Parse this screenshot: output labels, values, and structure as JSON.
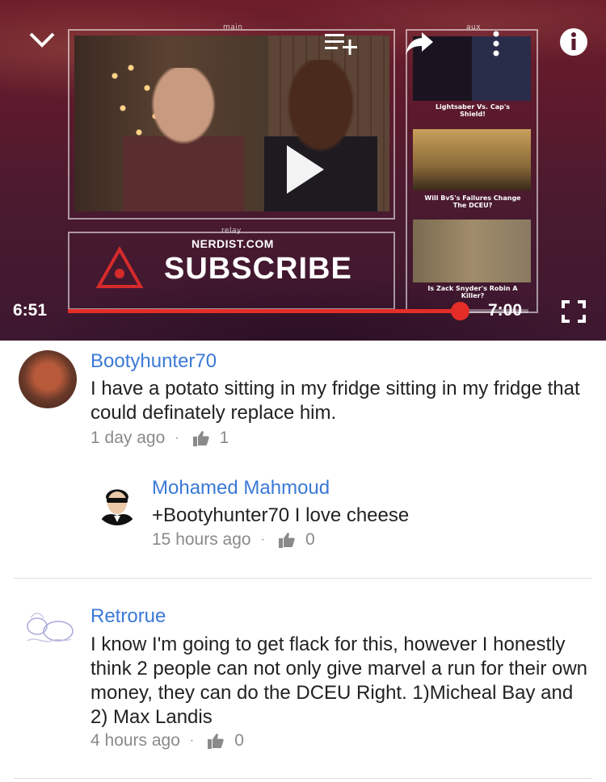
{
  "player": {
    "frame_main_label": "main",
    "frame_aux_label": "aux",
    "frame_relay_label": "relay",
    "nerdist": "NERDIST.COM",
    "subscribe": "SUBSCRIBE",
    "thumbs": [
      {
        "caption": "Lightsaber Vs. Cap's Shield!"
      },
      {
        "caption": "Will BvS's Failures Change The DCEU?"
      },
      {
        "caption": "Is Zack Snyder's Robin A Killer?"
      }
    ],
    "current_time": "6:51",
    "end_time": "7:00",
    "progress_fraction": 0.85,
    "icons": [
      "chevron-down-icon",
      "add-to-playlist-icon",
      "share-icon",
      "more-vert-icon",
      "info-icon",
      "fullscreen-icon",
      "play-icon",
      "warning-icon"
    ],
    "accent_color": "#e52d27"
  },
  "comments": [
    {
      "author": "Bootyhunter70",
      "text": "I have a potato sitting in my fridge sitting in my fridge that could definately replace him.",
      "time": "1 day ago",
      "likes": "1",
      "replies": [
        {
          "author": "Mohamed Mahmoud",
          "text": "+Bootyhunter70  I love cheese",
          "time": "15 hours ago",
          "likes": "0"
        }
      ]
    },
    {
      "author": "Retrorue",
      "text": "I know I'm going to get flack for this, however I honestly think 2 people can not only give marvel a run for their own money, they can do the DCEU Right. 1)Micheal Bay and 2) Max Landis",
      "time": "4 hours ago",
      "likes": "0"
    }
  ],
  "colors": {
    "author_link": "#3b79d6",
    "meta_text": "#8a8a8a"
  }
}
